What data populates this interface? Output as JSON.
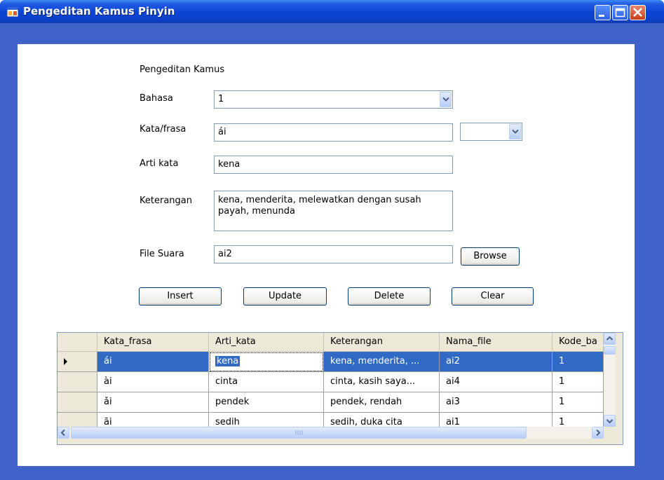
{
  "window": {
    "title": "Pengeditan Kamus Pinyin"
  },
  "form": {
    "heading": "Pengeditan Kamus",
    "bahasa_label": "Bahasa",
    "bahasa_value": "1",
    "kata_label": "Kata/frasa",
    "kata_value": "ái",
    "kata_combo_value": "",
    "arti_label": "Arti kata",
    "arti_value": "kena",
    "keterangan_label": "Keterangan",
    "keterangan_value": "kena, menderita, melewatkan dengan susah payah, menunda",
    "file_label": "File Suara",
    "file_value": "ai2",
    "browse_label": "Browse"
  },
  "buttons": {
    "insert": "Insert",
    "update": "Update",
    "delete": "Delete",
    "clear": "Clear"
  },
  "grid": {
    "columns": [
      "Kata_frasa",
      "Arti_kata",
      "Keterangan",
      "Nama_file",
      "Kode_ba"
    ],
    "rows": [
      [
        "ái",
        "kena",
        "kena, menderita, ...",
        "ai2",
        "1"
      ],
      [
        "ài",
        "cinta",
        "cinta, kasih saya...",
        "ai4",
        "1"
      ],
      [
        "ǎi",
        "pendek",
        "pendek, rendah",
        "ai3",
        "1"
      ],
      [
        "āi",
        "sedih",
        "sedih, duka cita",
        "ai1",
        "1"
      ]
    ],
    "selected_row": 0
  },
  "colors": {
    "titlebar": "#0a3fc9",
    "frame": "#3f62c8",
    "selection": "#316ac5"
  },
  "icons": [
    "app-icon",
    "minimize-icon",
    "maximize-icon",
    "close-icon",
    "dropdown-arrow-icon",
    "row-indicator-icon",
    "scroll-up-icon",
    "scroll-down-icon",
    "scroll-left-icon",
    "scroll-right-icon"
  ]
}
